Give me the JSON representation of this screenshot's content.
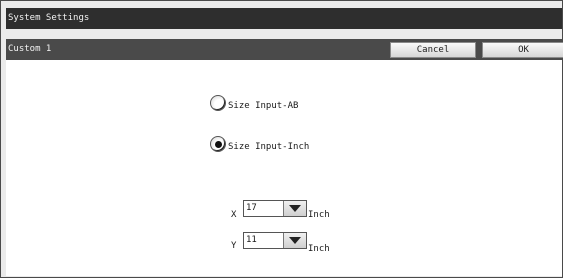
{
  "window": {
    "title": "System Settings"
  },
  "header": {
    "title": "Custom 1",
    "cancel_label": "Cancel",
    "ok_label": "OK"
  },
  "radio_options": [
    {
      "label": "Size Input-AB",
      "checked": false
    },
    {
      "label": "Size Input-Inch",
      "checked": true
    }
  ],
  "dimensions": {
    "x": {
      "label": "X",
      "value": "17",
      "unit": "Inch"
    },
    "y": {
      "label": "Y",
      "value": "11",
      "unit": "Inch"
    }
  }
}
